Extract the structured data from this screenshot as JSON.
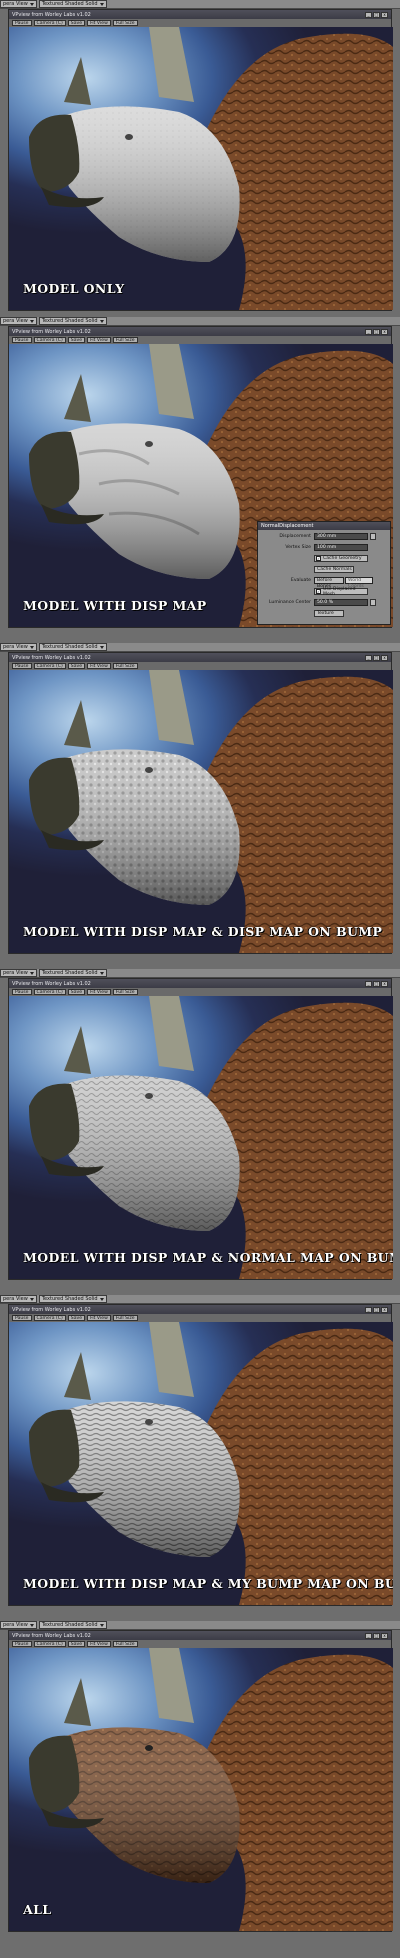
{
  "app": {
    "window_title": "VPview from Worley Labs v1.02",
    "toolbar": [
      "Pause",
      "Camera (C)",
      "Save",
      "Fit View",
      "Full Size"
    ],
    "strip_view_label": "pera View",
    "strip_mode_label": "Textured Shaded Solid"
  },
  "panels": [
    {
      "caption": "MODEL ONLY",
      "skin": "smooth"
    },
    {
      "caption": "MODEL WITH DISP MAP",
      "skin": "disp"
    },
    {
      "caption": "MODEL WITH DISP MAP & DISP MAP ON BUMP",
      "skin": "bumpy"
    },
    {
      "caption": "MODEL WITH DISP MAP & NORMAL MAP ON BUMP",
      "skin": "normal"
    },
    {
      "caption": "MODEL WITH DISP MAP & MY BUMP MAP ON BUMP",
      "skin": "wrinkled"
    },
    {
      "caption": "ALL",
      "skin": "textured"
    }
  ],
  "normal_displacement": {
    "title": "NormalDisplacement",
    "displacement_label": "Displacement",
    "displacement_value": "300 mm",
    "vertex_size_label": "Vertex Size",
    "vertex_size_value": "100 mm",
    "cache_geometry_label": "Cache Geometry",
    "cache_normals_label": "Cache Normals",
    "evaluate_label": "Evaluate",
    "evaluate_before": "Before Bones",
    "evaluate_world": "World Coords",
    "use_displaced_mesh_label": "Use Displaced Mesh",
    "luminance_center_label": "Luminance Center",
    "luminance_center_value": "50.0 %",
    "texture_label": "Texture"
  },
  "colors": {
    "sky_top": "#bcd6ec",
    "sky_bottom": "#1f2038",
    "beak": "#3a3a2e",
    "skin_light": "#d8d8d8",
    "frill_brown": "#7a4a2a",
    "horn": "#9a9a88"
  }
}
